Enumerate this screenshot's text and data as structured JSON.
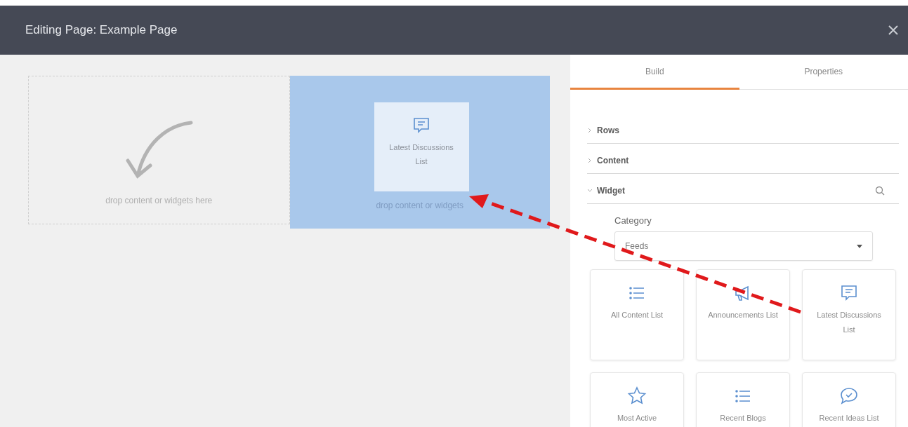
{
  "window": {
    "title": "Editing Page: Example Page"
  },
  "canvas": {
    "dropzones": [
      {
        "hint": "drop content or widgets here",
        "highlighted": false
      },
      {
        "hint": "drop content or widgets",
        "highlighted": true,
        "dragged_widget": {
          "label": "Latest Discussions List",
          "kind": "chat"
        }
      }
    ]
  },
  "panel": {
    "tabs": [
      {
        "label": "Build",
        "selected": true
      },
      {
        "label": "Properties",
        "selected": false
      }
    ],
    "sections": [
      {
        "label": "Rows",
        "expanded": false
      },
      {
        "label": "Content",
        "expanded": false
      },
      {
        "label": "Widget",
        "expanded": true,
        "searchable": true
      }
    ],
    "category": {
      "label": "Category",
      "value": "Feeds"
    },
    "widgets": [
      {
        "label": "All Content List",
        "kind": "list"
      },
      {
        "label": "Announcements List",
        "kind": "megaphone"
      },
      {
        "label": "Latest Discussions List",
        "kind": "chat"
      },
      {
        "label": "Most Active",
        "kind": "star"
      },
      {
        "label": "Recent Blogs",
        "kind": "list"
      },
      {
        "label": "Recent Ideas List",
        "kind": "checkchat"
      }
    ]
  }
}
